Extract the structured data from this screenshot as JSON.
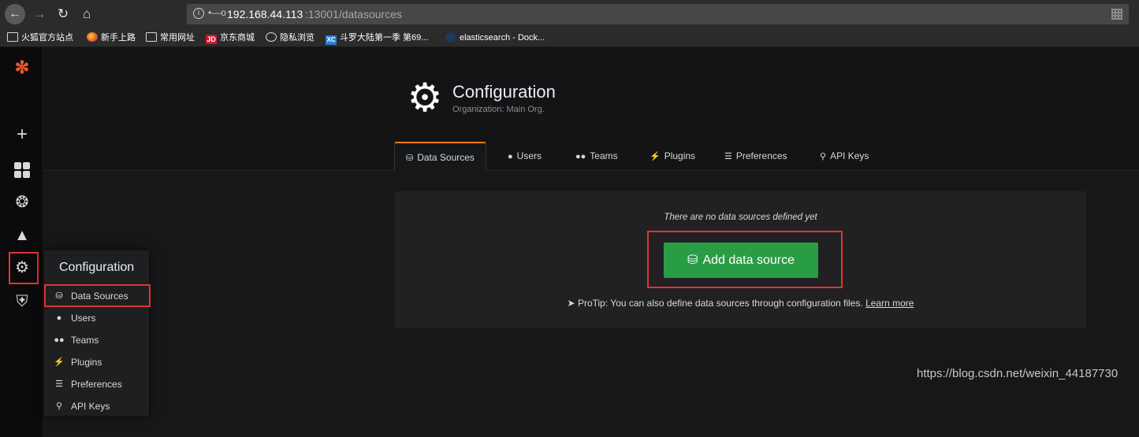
{
  "browser": {
    "host": "192.168.44.113",
    "path": ":13001/datasources",
    "bookmarks": [
      {
        "label": "火狐官方站点",
        "icon": "folder-icon"
      },
      {
        "label": "新手上路",
        "icon": "firefox-icon"
      },
      {
        "label": "常用网址",
        "icon": "folder-icon"
      },
      {
        "label": "京东商城",
        "icon": "jd-icon"
      },
      {
        "label": "隐私浏览",
        "icon": "globe-icon"
      },
      {
        "label": "斗罗大陆第一季 第69...",
        "icon": "xc-icon"
      },
      {
        "label": "elasticsearch - Dock...",
        "icon": "docker-icon"
      }
    ]
  },
  "header": {
    "title": "Configuration",
    "subtitle": "Organization: Main Org."
  },
  "tabs": [
    {
      "label": "Data Sources",
      "icon": "database-icon",
      "active": true
    },
    {
      "label": "Users",
      "icon": "user-icon"
    },
    {
      "label": "Teams",
      "icon": "users-icon"
    },
    {
      "label": "Plugins",
      "icon": "plug-icon"
    },
    {
      "label": "Preferences",
      "icon": "sliders-icon"
    },
    {
      "label": "API Keys",
      "icon": "key-icon"
    }
  ],
  "flyout": {
    "title": "Configuration",
    "items": [
      {
        "label": "Data Sources",
        "icon": "database-icon"
      },
      {
        "label": "Users",
        "icon": "user-icon"
      },
      {
        "label": "Teams",
        "icon": "users-icon"
      },
      {
        "label": "Plugins",
        "icon": "plug-icon"
      },
      {
        "label": "Preferences",
        "icon": "sliders-icon"
      },
      {
        "label": "API Keys",
        "icon": "key-icon"
      }
    ]
  },
  "empty": {
    "message": "There are no data sources defined yet",
    "button_label": "Add data source",
    "protip": "ProTip: You can also define data sources through configuration files.",
    "protip_link": "Learn more"
  },
  "watermark": "https://blog.csdn.net/weixin_44187730",
  "colors": {
    "accent": "#eb7b18",
    "primary_button": "#299c46",
    "highlight": "#e03331"
  }
}
